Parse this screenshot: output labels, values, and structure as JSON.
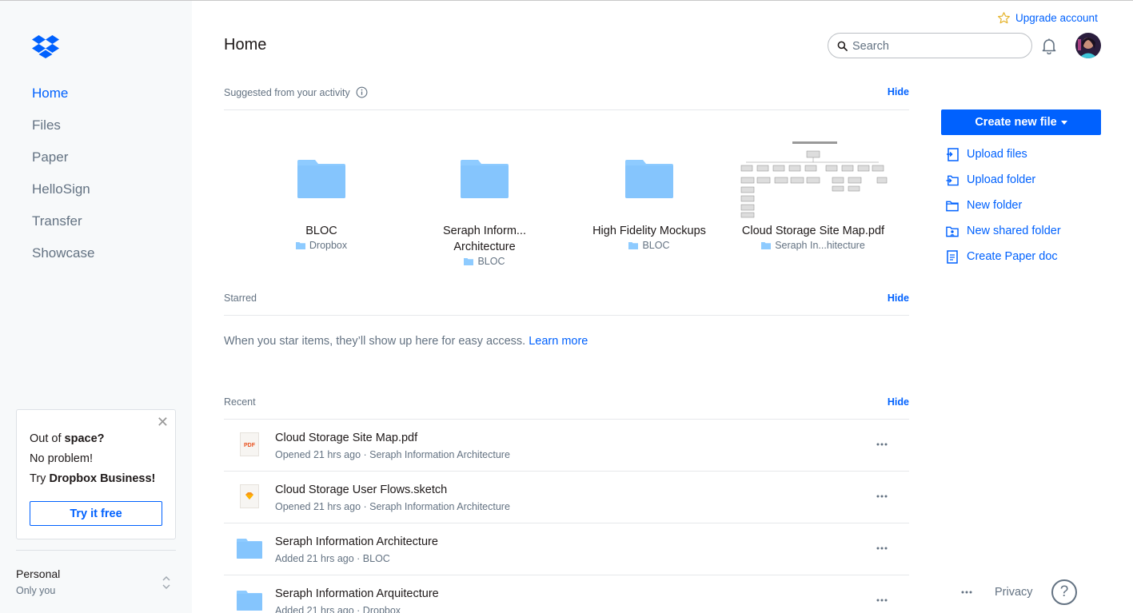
{
  "sidebar": {
    "nav": [
      {
        "label": "Home",
        "active": true
      },
      {
        "label": "Files"
      },
      {
        "label": "Paper"
      },
      {
        "label": "HelloSign"
      },
      {
        "label": "Transfer"
      },
      {
        "label": "Showcase"
      }
    ],
    "promo": {
      "line1_prefix": "Out of ",
      "line1_bold": "space?",
      "line2": "No problem!",
      "line3_prefix": "Try ",
      "line3_bold": "Dropbox Business!",
      "button": "Try it free",
      "close": "✕"
    },
    "account": {
      "name": "Personal",
      "sub": "Only you"
    }
  },
  "header": {
    "title": "Home",
    "upgrade": "Upgrade account",
    "search_placeholder": "Search"
  },
  "suggested": {
    "title": "Suggested from your activity",
    "hide": "Hide",
    "items": [
      {
        "name": "BLOC",
        "location": "Dropbox",
        "type": "folder"
      },
      {
        "name": "Seraph Inform...\nArchitecture",
        "location": "BLOC",
        "type": "folder"
      },
      {
        "name": "High Fidelity Mockups",
        "location": "BLOC",
        "type": "folder"
      },
      {
        "name": "Cloud Storage Site Map.pdf",
        "location": "Seraph In...hitecture",
        "type": "pdf-preview"
      }
    ]
  },
  "starred": {
    "title": "Starred",
    "hide": "Hide",
    "message": "When you star items, they’ll show up here for easy access.",
    "link": "Learn more"
  },
  "recent": {
    "title": "Recent",
    "hide": "Hide",
    "items": [
      {
        "name": "Cloud Storage Site Map.pdf",
        "meta": "Opened 21 hrs ago · Seraph Information Architecture",
        "icon": "pdf-icon",
        "badge": "PDF"
      },
      {
        "name": "Cloud Storage User Flows.sketch",
        "meta": "Opened 21 hrs ago · Seraph Information Architecture",
        "icon": "sketch-icon"
      },
      {
        "name": "Seraph Information Architecture",
        "meta": "Added 21 hrs ago · BLOC",
        "icon": "folder-icon"
      },
      {
        "name": "Seraph Information Arquitecture",
        "meta": "Added 21 hrs ago · Dropbox",
        "icon": "folder-icon"
      }
    ]
  },
  "actions": {
    "create": "Create new file",
    "items": [
      {
        "label": "Upload files",
        "icon": "upload-files-icon"
      },
      {
        "label": "Upload folder",
        "icon": "upload-folder-icon"
      },
      {
        "label": "New folder",
        "icon": "new-folder-icon"
      },
      {
        "label": "New shared folder",
        "icon": "shared-folder-icon"
      },
      {
        "label": "Create Paper doc",
        "icon": "paper-doc-icon"
      }
    ]
  },
  "footer": {
    "privacy": "Privacy",
    "help": "?"
  },
  "colors": {
    "accent": "#0061fe",
    "folder": "#8ecbff",
    "muted": "#637282"
  }
}
